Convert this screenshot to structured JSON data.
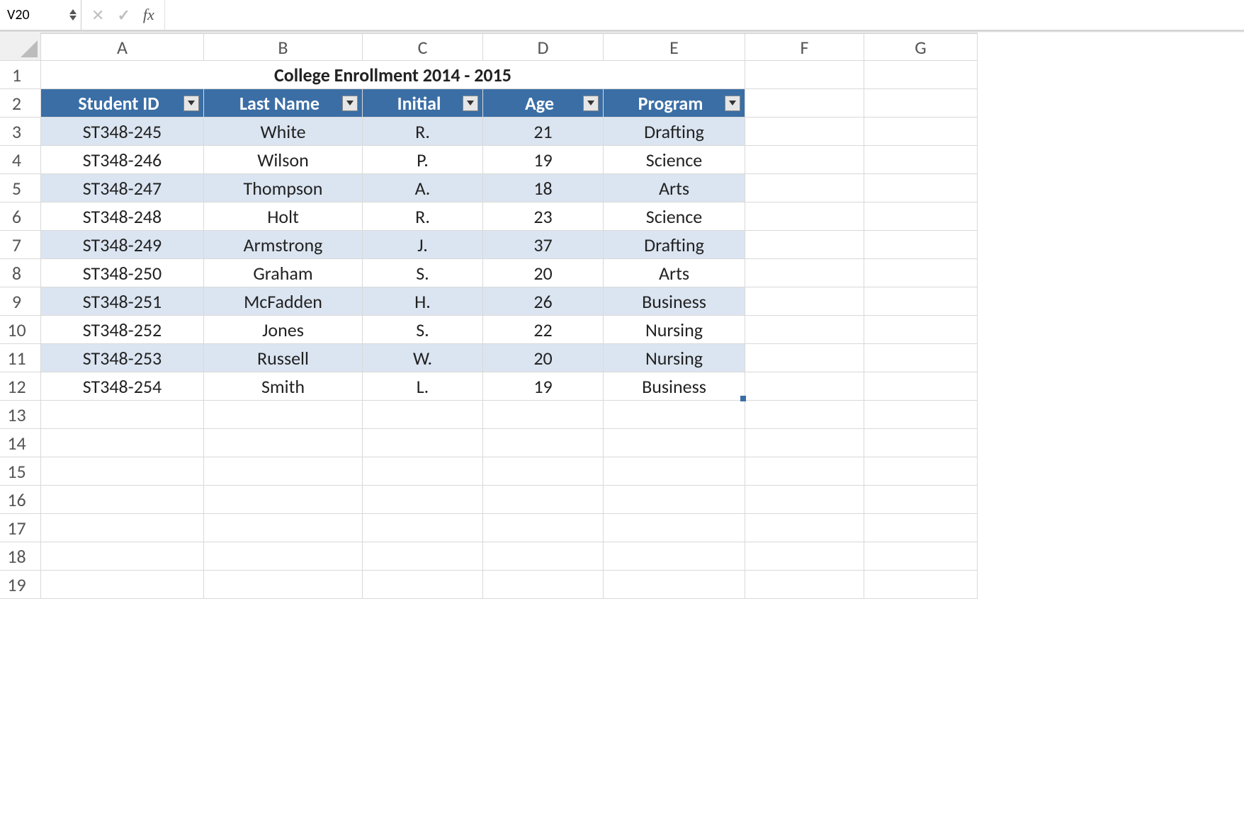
{
  "formula_bar": {
    "name_box_value": "V20",
    "fx_label": "fx",
    "input_value": ""
  },
  "columns": [
    "A",
    "B",
    "C",
    "D",
    "E",
    "F",
    "G"
  ],
  "rows": [
    "1",
    "2",
    "3",
    "4",
    "5",
    "6",
    "7",
    "8",
    "9",
    "10",
    "11",
    "12",
    "13",
    "14",
    "15",
    "16",
    "17",
    "18",
    "19"
  ],
  "title": "College Enrollment 2014 - 2015",
  "headers": {
    "student_id": "Student ID",
    "last_name": "Last Name",
    "initial": "Initial",
    "age": "Age",
    "program": "Program"
  },
  "records": [
    {
      "id": "ST348-245",
      "last": "White",
      "init": "R.",
      "age": "21",
      "program": "Drafting"
    },
    {
      "id": "ST348-246",
      "last": "Wilson",
      "init": "P.",
      "age": "19",
      "program": "Science"
    },
    {
      "id": "ST348-247",
      "last": "Thompson",
      "init": "A.",
      "age": "18",
      "program": "Arts"
    },
    {
      "id": "ST348-248",
      "last": "Holt",
      "init": "R.",
      "age": "23",
      "program": "Science"
    },
    {
      "id": "ST348-249",
      "last": "Armstrong",
      "init": "J.",
      "age": "37",
      "program": "Drafting"
    },
    {
      "id": "ST348-250",
      "last": "Graham",
      "init": "S.",
      "age": "20",
      "program": "Arts"
    },
    {
      "id": "ST348-251",
      "last": "McFadden",
      "init": "H.",
      "age": "26",
      "program": "Business"
    },
    {
      "id": "ST348-252",
      "last": "Jones",
      "init": "S.",
      "age": "22",
      "program": "Nursing"
    },
    {
      "id": "ST348-253",
      "last": "Russell",
      "init": "W.",
      "age": "20",
      "program": "Nursing"
    },
    {
      "id": "ST348-254",
      "last": "Smith",
      "init": "L.",
      "age": "19",
      "program": "Business"
    }
  ]
}
